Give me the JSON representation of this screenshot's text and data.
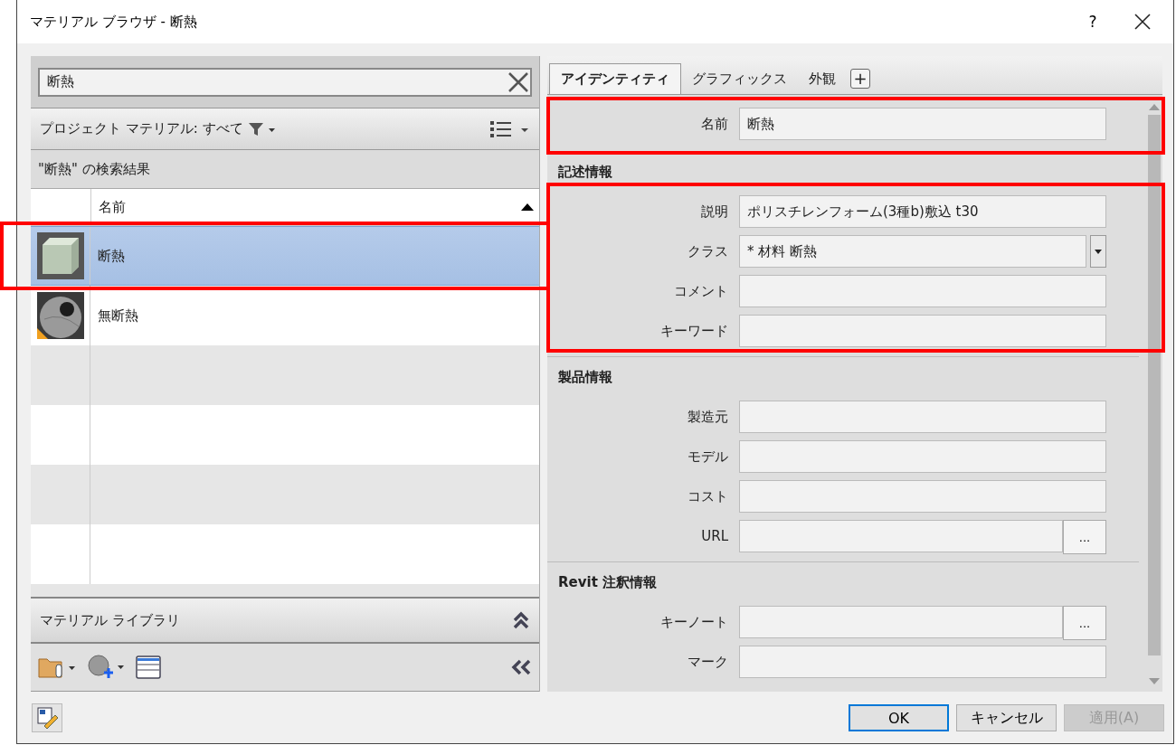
{
  "window": {
    "title": "マテリアル ブラウザ - 断熱",
    "help": "?"
  },
  "search": {
    "value": "断熱"
  },
  "filter": {
    "label": "プロジェクト マテリアル: すべて"
  },
  "results_header": "\"断熱\" の検索結果",
  "table": {
    "columns": [
      "名前"
    ],
    "rows": [
      {
        "name": "断熱",
        "selected": true,
        "kind": "cube",
        "warning": false
      },
      {
        "name": "無断熱",
        "selected": false,
        "kind": "sphere",
        "warning": true
      }
    ]
  },
  "library": {
    "title": "マテリアル ライブラリ"
  },
  "tabs": [
    {
      "label": "アイデンティティ",
      "selected": true
    },
    {
      "label": "グラフィックス",
      "selected": false
    },
    {
      "label": "外観",
      "selected": false
    }
  ],
  "add_tab": "+",
  "name_field": {
    "label": "名前",
    "value": "断熱"
  },
  "sections": [
    {
      "title": "記述情報",
      "fields": [
        {
          "label": "説明",
          "value": "ポリスチレンフォーム(3種b)敷込 t30",
          "kind": "text"
        },
        {
          "label": "クラス",
          "value": "* 材料 断熱",
          "kind": "dropdown"
        },
        {
          "label": "コメント",
          "kind": "text"
        },
        {
          "label": "キーワード",
          "kind": "text"
        }
      ]
    },
    {
      "title": "製品情報",
      "fields": [
        {
          "label": "製造元",
          "kind": "text"
        },
        {
          "label": "モデル",
          "kind": "text"
        },
        {
          "label": "コスト",
          "kind": "text"
        },
        {
          "label": "URL",
          "kind": "browse",
          "button": "..."
        }
      ]
    },
    {
      "title": "Revit 注釈情報",
      "fields": [
        {
          "label": "キーノート",
          "kind": "browse",
          "button": "..."
        },
        {
          "label": "マーク",
          "kind": "text"
        }
      ]
    }
  ],
  "buttons": [
    {
      "label": "OK",
      "default": true,
      "disabled": false
    },
    {
      "label": "キャンセル",
      "default": false,
      "disabled": false
    },
    {
      "label": "適用(A)",
      "default": false,
      "disabled": true
    }
  ]
}
